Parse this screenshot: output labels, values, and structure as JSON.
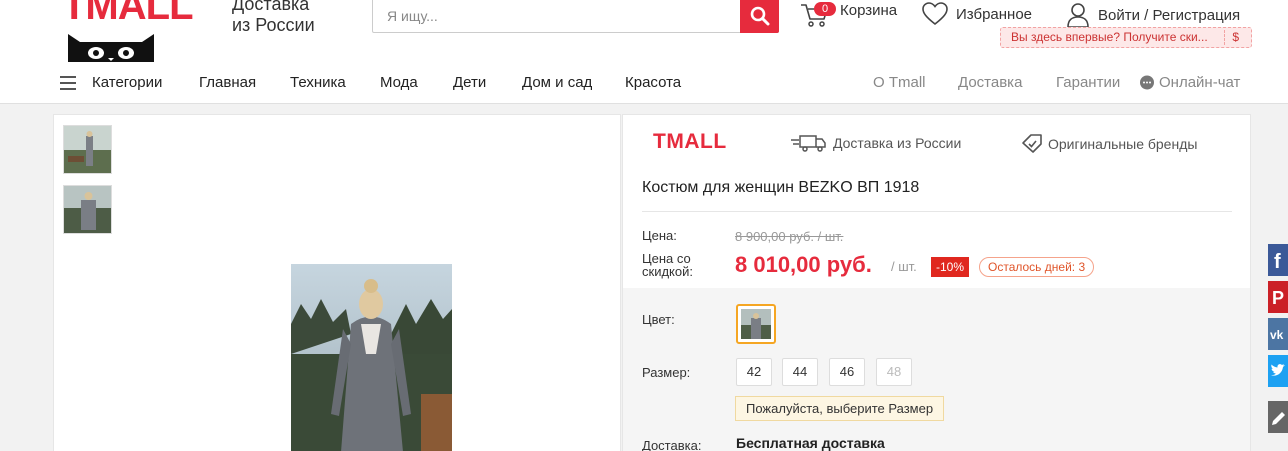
{
  "header": {
    "logo_text": "TMALL",
    "tagline_line1": "Доставка",
    "tagline_line2": "из России",
    "search_placeholder": "Я ищу...",
    "cart_count": "0",
    "cart_label": "Корзина",
    "favorites_label": "Избранное",
    "login_label": "Войти / Регистрация",
    "promo_text": "Вы здесь впервые? Получите ски...",
    "promo_symbol": "$"
  },
  "nav": {
    "categories_label": "Категории",
    "items": [
      "Главная",
      "Техника",
      "Мода",
      "Дети",
      "Дом и сад",
      "Красота"
    ],
    "right_items": [
      "О Tmall",
      "Доставка",
      "Гарантии"
    ],
    "chat_label": "Онлайн-чат"
  },
  "product": {
    "brand_logo": "TMALL",
    "delivery_badge": "Доставка из России",
    "brands_badge": "Оригинальные бренды",
    "title": "Костюм для женщин BEZKO ВП 1918",
    "price_label": "Цена:",
    "old_price": "8 900,00 руб. / шт.",
    "discount_price_label_line1": "Цена со",
    "discount_price_label_line2": "скидкой:",
    "new_price": "8 010,00 руб.",
    "unit": "/ шт.",
    "discount_badge": "-10%",
    "days_left": "Осталось дней: 3",
    "color_label": "Цвет:",
    "size_label": "Размер:",
    "sizes": [
      "42",
      "44",
      "46",
      "48"
    ],
    "size_hint": "Пожалуйста, выберите Размер",
    "delivery_label": "Доставка:",
    "delivery_value": "Бесплатная доставка"
  },
  "colors": {
    "brand_red": "#e62b3d",
    "discount_red": "#e0281f",
    "swatch_border": "#f5a623",
    "facebook": "#3b5998",
    "pinterest": "#cb2027",
    "vk": "#4c75a3",
    "twitter": "#1da1f2",
    "edit": "#666666"
  },
  "icons": {
    "search": "search-icon",
    "cart": "cart-icon",
    "favorites": "heart-icon",
    "login": "user-icon",
    "menu": "hamburger-icon",
    "chat": "chat-bubble-icon",
    "truck": "truck-icon",
    "brand_tag": "tag-icon",
    "share": [
      "facebook-icon",
      "pinterest-icon",
      "vk-icon",
      "twitter-icon",
      "pencil-icon"
    ]
  }
}
